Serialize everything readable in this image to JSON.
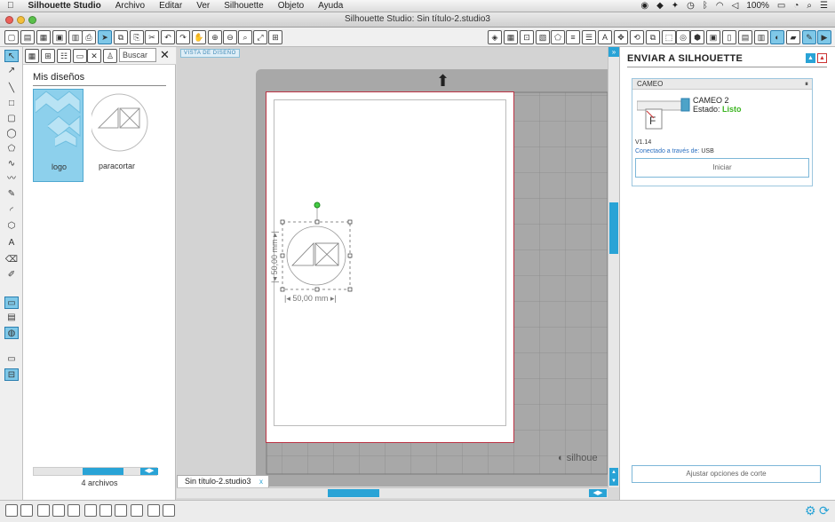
{
  "menubar": {
    "app_name": "Silhouette Studio",
    "items": [
      "Archivo",
      "Editar",
      "Ver",
      "Silhouette",
      "Objeto",
      "Ayuda"
    ],
    "battery": "100%"
  },
  "window": {
    "title": "Silhouette Studio: Sin título-2.studio3"
  },
  "library": {
    "search_placeholder": "Buscar",
    "section_title": "Mis diseños",
    "thumbnails": [
      {
        "label": "logo",
        "selected": true
      },
      {
        "label": "paracortar",
        "selected": false
      }
    ],
    "count_label": "4 archivos"
  },
  "workarea": {
    "view_tag": "VISTA DE DISEÑO",
    "doc_tab": "Sin título-2.studio3",
    "width_dim": "50,00 mm",
    "height_dim": "50,00 mm",
    "brand_text": "silhoue"
  },
  "send_panel": {
    "title": "ENVIAR A SILHOUETTE",
    "device_header": "CAMEO",
    "device_name": "CAMEO 2",
    "status_label": "Estado:",
    "status_value": "Listo",
    "version": "V1.14",
    "connection_label": "Conectado a través de:",
    "connection_value": "USB",
    "start_button": "Iniciar",
    "adjust_button": "Ajustar opciones de corte"
  },
  "colors": {
    "accent": "#29a3d6",
    "status_ready": "#3cb521",
    "selected_thumb": "#8dd0ec"
  }
}
